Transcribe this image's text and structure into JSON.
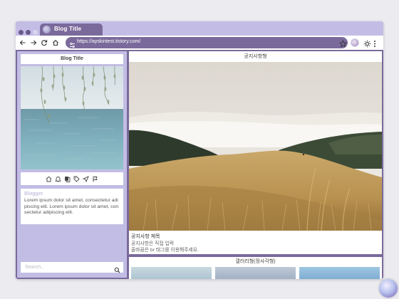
{
  "browser": {
    "tab_title": "Blog Title",
    "url": "https://ayskintest.tistory.com/",
    "colors": {
      "frame": "#7a6a9b",
      "tab_strip": "#c3bde6",
      "sidebar": "#c2bde4"
    }
  },
  "sidebar": {
    "title": "Blog Title",
    "icons": [
      "home-icon",
      "bell-icon",
      "categories-icon",
      "tags-icon",
      "send-icon",
      "flag-icon"
    ],
    "about_title": "Blogger",
    "about_text": "Lorem ipsum dolor sit amet, consectetur adipiscing elit. Lorem ipsum dolor sit amet, consectetur adipiscing elit.",
    "search_placeholder": "Search.."
  },
  "main": {
    "notice_header": "공지사항형",
    "notice_title": "공지사항 제목",
    "notice_body_line1": "공지사항은 직접 입력",
    "notice_body_line2": "줄바꿈은 br 태그를 이용해주세요.",
    "gallery_header": "갤러리형(정사각형)"
  }
}
